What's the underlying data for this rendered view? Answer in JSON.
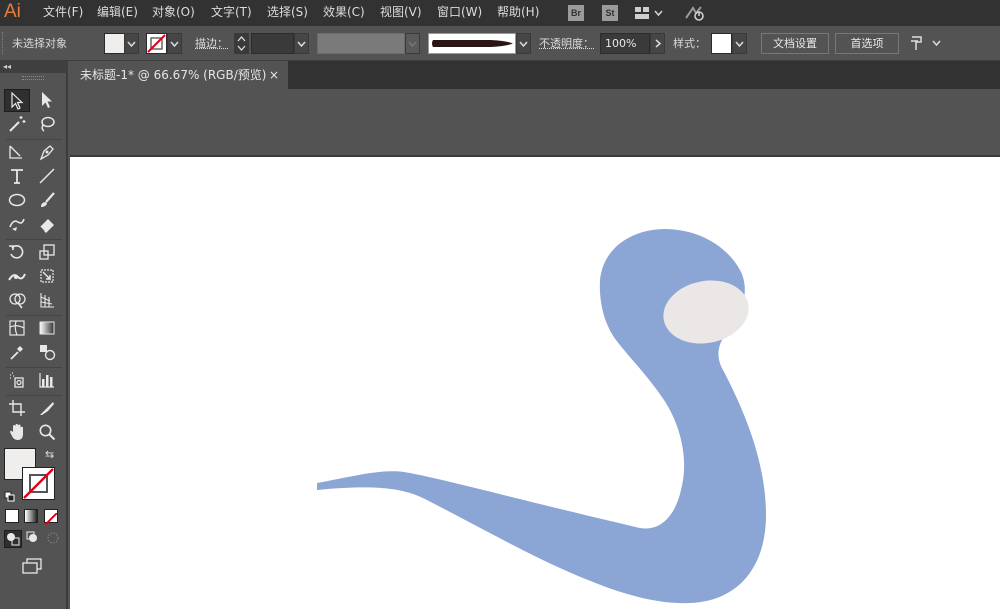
{
  "app": {
    "logo": "Ai"
  },
  "menu": {
    "items": [
      "文件(F)",
      "编辑(E)",
      "对象(O)",
      "文字(T)",
      "选择(S)",
      "效果(C)",
      "视图(V)",
      "窗口(W)",
      "帮助(H)"
    ],
    "bridge_badge": "Br",
    "stock_badge": "St",
    "workspace_icon": "layout-icon",
    "gpu_icon": "gpu-performance-icon"
  },
  "control_bar": {
    "selection_status": "未选择对象",
    "stroke_label": "描边：",
    "opacity_label": "不透明度：",
    "opacity_value": "100%",
    "style_label": "样式：",
    "document_setup_button": "文档设置",
    "preferences_button": "首选项"
  },
  "colors": {
    "fill": "#f0eeed",
    "stroke": "none",
    "shape_body": "#8ba5d4",
    "shape_eye": "#eae7e6",
    "accent_logo": "#e97e3a"
  },
  "document": {
    "tab_title": "未标题-1* @ 66.67% (RGB/预览)",
    "tab_close": "×",
    "zoom": "66.67%",
    "color_mode": "RGB"
  },
  "tools": [
    {
      "name": "selection-tool",
      "selected": true
    },
    {
      "name": "direct-selection-tool"
    },
    {
      "name": "magic-wand-tool"
    },
    {
      "name": "lasso-tool"
    },
    {
      "name": "pen-tool"
    },
    {
      "name": "curvature-tool"
    },
    {
      "name": "type-tool"
    },
    {
      "name": "line-segment-tool"
    },
    {
      "name": "ellipse-tool"
    },
    {
      "name": "paintbrush-tool"
    },
    {
      "name": "shaper-tool"
    },
    {
      "name": "eraser-tool"
    },
    {
      "name": "rotate-tool"
    },
    {
      "name": "scale-tool"
    },
    {
      "name": "width-tool"
    },
    {
      "name": "free-transform-tool"
    },
    {
      "name": "shape-builder-tool"
    },
    {
      "name": "perspective-grid-tool"
    },
    {
      "name": "mesh-tool"
    },
    {
      "name": "gradient-tool"
    },
    {
      "name": "eyedropper-tool"
    },
    {
      "name": "blend-tool"
    },
    {
      "name": "symbol-sprayer-tool"
    },
    {
      "name": "column-graph-tool"
    },
    {
      "name": "artboard-tool"
    },
    {
      "name": "slice-tool"
    },
    {
      "name": "hand-tool"
    },
    {
      "name": "zoom-tool"
    }
  ]
}
